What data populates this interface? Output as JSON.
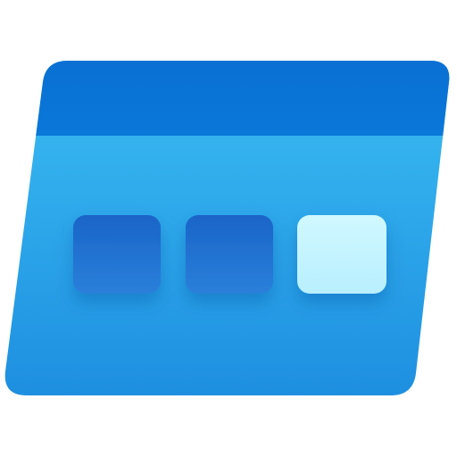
{
  "icon": {
    "name": "storage-explorer-icon",
    "colors": {
      "body_top": "#3bbdf3",
      "body_bottom": "#1e8fe0",
      "header_top": "#0a6fd3",
      "header_bottom": "#0a78d9",
      "tile_dark_top": "#1a64c8",
      "tile_dark_bottom": "#2a80da",
      "tile_light_top": "#d0f8ff",
      "tile_light_bottom": "#b8efff"
    },
    "tiles": [
      {
        "role": "dark"
      },
      {
        "role": "dark"
      },
      {
        "role": "light"
      }
    ]
  }
}
